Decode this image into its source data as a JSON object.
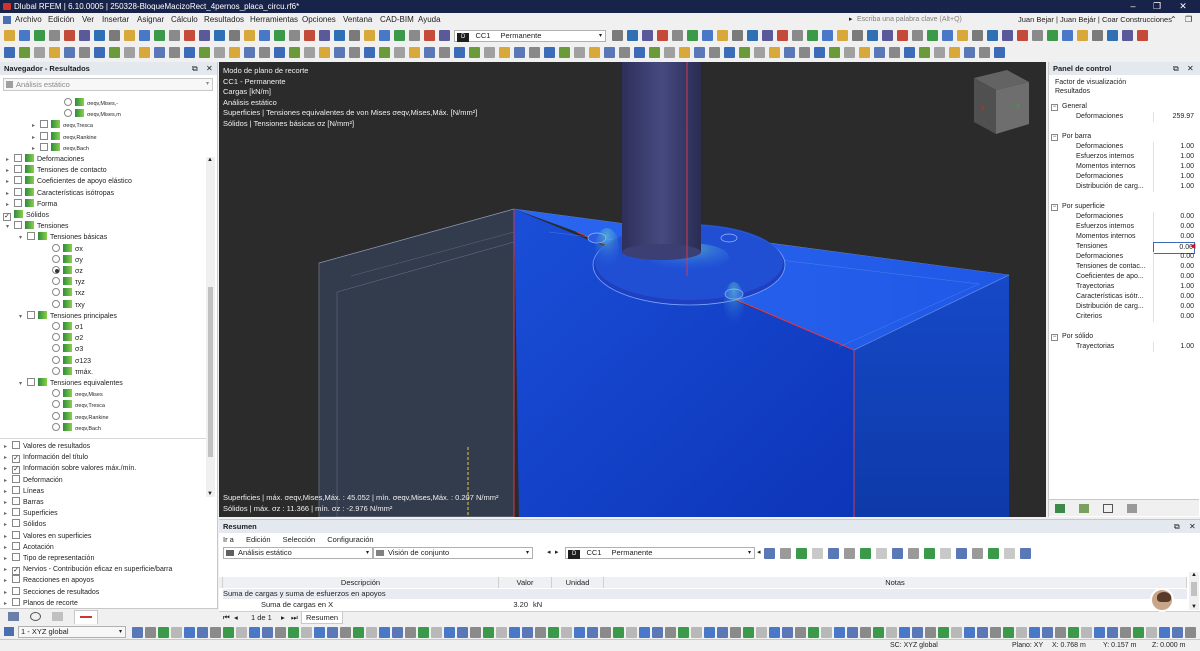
{
  "app": {
    "title": "Dlubal RFEM | 6.10.0005 | 250328-BloqueMacizoRect_4pernos_placa_circu.rf6*"
  },
  "menu": [
    "Archivo",
    "Edición",
    "Ver",
    "Insertar",
    "Asignar",
    "Cálculo",
    "Resultados",
    "Herramientas",
    "Opciones",
    "Ventana",
    "CAD-BIM",
    "Ayuda"
  ],
  "search": {
    "placeholder": "Escriba una palabra clave (Alt+Q)"
  },
  "user": {
    "name": "Juan Bejar | Juan Bejár | Coar Construcciones"
  },
  "toolbar": {
    "lc_badge": "D",
    "lc_code": "CC1",
    "lc_name": "Permanente"
  },
  "navigator": {
    "title": "Navegador - Resultados",
    "analysis": "Análisis estático",
    "tree": [
      {
        "label": "σeqv,Mises,-"
      },
      {
        "label": "σeqv,Mises,m"
      },
      {
        "label": "σeqv,Tresca"
      },
      {
        "label": "σeqv,Rankine"
      },
      {
        "label": "σeqv,Bach"
      },
      {
        "label": "Deformaciones"
      },
      {
        "label": "Tensiones de contacto"
      },
      {
        "label": "Coeficientes de apoyo elástico"
      },
      {
        "label": "Características isótropas"
      },
      {
        "label": "Forma"
      },
      {
        "label": "Sólidos"
      },
      {
        "label": "Tensiones"
      },
      {
        "label": "Tensiones básicas"
      },
      {
        "label": "σx"
      },
      {
        "label": "σy"
      },
      {
        "label": "σz"
      },
      {
        "label": "τyz"
      },
      {
        "label": "τxz"
      },
      {
        "label": "τxy"
      },
      {
        "label": "Tensiones principales"
      },
      {
        "label": "σ1"
      },
      {
        "label": "σ2"
      },
      {
        "label": "σ3"
      },
      {
        "label": "σ123"
      },
      {
        "label": "τmáx."
      },
      {
        "label": "Tensiones equivalentes"
      },
      {
        "label": "σeqv,Mises"
      },
      {
        "label": "σeqv,Tresca"
      },
      {
        "label": "σeqv,Rankine"
      },
      {
        "label": "σeqv,Bach"
      }
    ],
    "tree2": [
      {
        "label": "Valores de resultados"
      },
      {
        "label": "Información del título"
      },
      {
        "label": "Información sobre valores máx./mín."
      },
      {
        "label": "Deformación"
      },
      {
        "label": "Líneas"
      },
      {
        "label": "Barras"
      },
      {
        "label": "Superficies"
      },
      {
        "label": "Sólidos"
      },
      {
        "label": "Valores en superficies"
      },
      {
        "label": "Acotación"
      },
      {
        "label": "Tipo de representación"
      },
      {
        "label": "Nervios - Contribución eficaz en superficie/barra"
      },
      {
        "label": "Reacciones en apoyos"
      },
      {
        "label": "Secciones de resultados"
      },
      {
        "label": "Planos de recorte"
      }
    ]
  },
  "viewport": {
    "info": [
      "Modo de plano de recorte",
      "CC1 - Permanente",
      "Cargas [kN/m]",
      "Análisis estático",
      "Superficies | Tensiones equivalentes de von Mises σeqv,Mises,Máx. [N/mm²]",
      "Sólidos | Tensiones básicas σz [N/mm²]"
    ],
    "footer": [
      "Superficies | máx. σeqv,Mises,Máx. : 45.052 | mín. σeqv,Mises,Máx. : 0.207 N/mm²",
      "Sólidos | máx. σz : 11.366 | mín. σz : -2.976 N/mm²"
    ]
  },
  "control_panel": {
    "title": "Panel de control",
    "subtitle1": "Factor de visualización",
    "subtitle2": "Resultados",
    "sections": [
      {
        "name": "General",
        "rows": [
          {
            "label": "Deformaciones",
            "value": "259.97"
          }
        ]
      },
      {
        "name": "Por barra",
        "rows": [
          {
            "label": "Deformaciones",
            "value": "1.00"
          },
          {
            "label": "Esfuerzos internos",
            "value": "1.00"
          },
          {
            "label": "Momentos internos",
            "value": "1.00"
          },
          {
            "label": "Deformaciones",
            "value": "1.00"
          },
          {
            "label": "Distribución de carg...",
            "value": "1.00"
          }
        ]
      },
      {
        "name": "Por superficie",
        "rows": [
          {
            "label": "Deformaciones",
            "value": "0.00"
          },
          {
            "label": "Esfuerzos internos",
            "value": "0.00"
          },
          {
            "label": "Momentos internos",
            "value": "0.00"
          },
          {
            "label": "Tensiones",
            "value": "0.00"
          },
          {
            "label": "Deformaciones",
            "value": "0.00"
          },
          {
            "label": "Tensiones de contac...",
            "value": "0.00"
          },
          {
            "label": "Coeficientes de apo...",
            "value": "0.00"
          },
          {
            "label": "Trayectorias",
            "value": "1.00"
          },
          {
            "label": "Características isótr...",
            "value": "0.00"
          },
          {
            "label": "Distribución de carg...",
            "value": "0.00"
          },
          {
            "label": "Criterios",
            "value": "0.00"
          }
        ]
      },
      {
        "name": "Por sólido",
        "rows": [
          {
            "label": "Trayectorias",
            "value": "1.00"
          }
        ]
      }
    ]
  },
  "summary": {
    "title": "Resumen",
    "menu": [
      "Ir a",
      "Edición",
      "Selección",
      "Configuración"
    ],
    "analysis": "Análisis estático",
    "view": "Visión de conjunto",
    "lc_badge": "D",
    "lc_code": "CC1",
    "lc_name": "Permanente",
    "headers": [
      "Descripción",
      "Valor",
      "Unidad",
      "Notas"
    ],
    "group": "Suma de cargas y suma de esfuerzos en apoyos",
    "row": {
      "desc": "Suma de cargas en X",
      "value": "3.20",
      "unit": "kN"
    },
    "pager": "1 de 1",
    "tab": "Resumen"
  },
  "status": {
    "view": "1 - XYZ global",
    "cs": "SC: XYZ global",
    "plane": "Plano: XY",
    "x": "X: 0.768 m",
    "y": "Y: 0.157 m",
    "z": "Z: 0.000 m"
  }
}
